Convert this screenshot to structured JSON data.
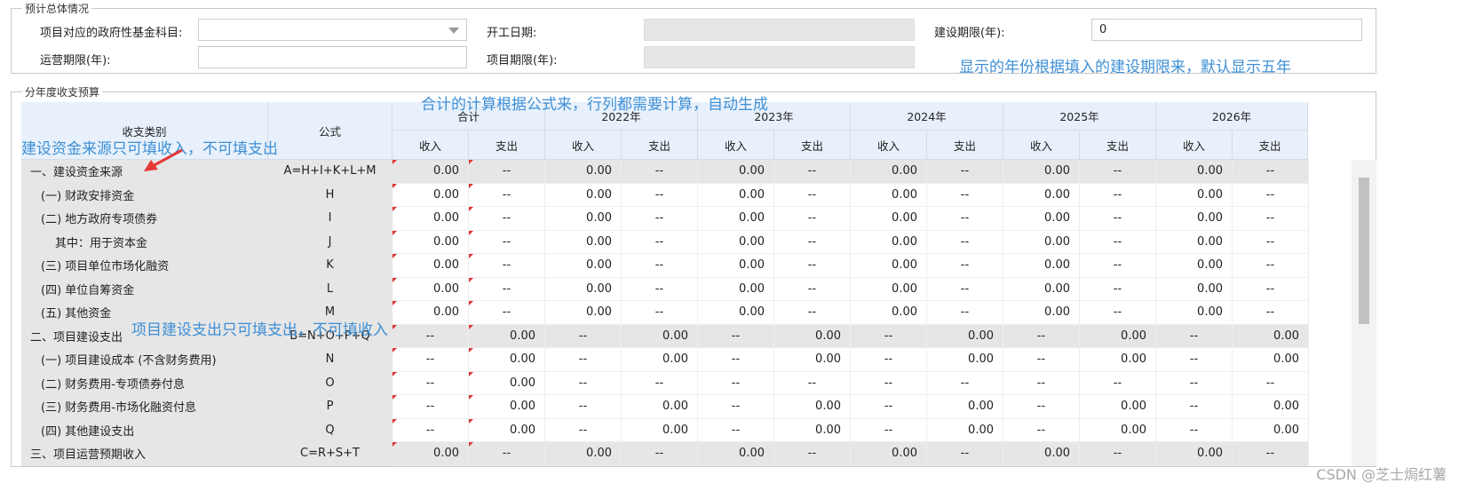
{
  "overview": {
    "legend": "预计总体情况",
    "fund_subject_label": "项目对应的政府性基金科目:",
    "fund_subject_value": "",
    "start_date_label": "开工日期:",
    "build_period_label": "建设期限(年):",
    "build_period_value": "0",
    "operate_period_label": "运营期限(年):",
    "operate_period_value": "",
    "project_period_label": "项目期限(年):"
  },
  "budget": {
    "legend": "分年度收支预算",
    "col_category": "收支类别",
    "col_formula": "公式",
    "groups": [
      "合计",
      "2022年",
      "2023年",
      "2024年",
      "2025年",
      "2026年"
    ],
    "income": "收入",
    "expense": "支出",
    "rows": [
      {
        "label": "一、建设资金来源",
        "formula": "A=H+I+K+L+M",
        "sec": true,
        "values": [
          "0.00",
          "--",
          "0.00",
          "--",
          "0.00",
          "--",
          "0.00",
          "--",
          "0.00",
          "--",
          "0.00",
          "--"
        ]
      },
      {
        "label": "(一) 财政安排资金",
        "formula": "H",
        "values": [
          "0.00",
          "--",
          "0.00",
          "--",
          "0.00",
          "--",
          "0.00",
          "--",
          "0.00",
          "--",
          "0.00",
          "--"
        ]
      },
      {
        "label": "(二) 地方政府专项债券",
        "formula": "I",
        "values": [
          "0.00",
          "--",
          "0.00",
          "--",
          "0.00",
          "--",
          "0.00",
          "--",
          "0.00",
          "--",
          "0.00",
          "--"
        ]
      },
      {
        "label": "其中：用于资本金",
        "formula": "J",
        "indent": true,
        "values": [
          "0.00",
          "--",
          "0.00",
          "--",
          "0.00",
          "--",
          "0.00",
          "--",
          "0.00",
          "--",
          "0.00",
          "--"
        ]
      },
      {
        "label": "(三) 项目单位市场化融资",
        "formula": "K",
        "values": [
          "0.00",
          "--",
          "0.00",
          "--",
          "0.00",
          "--",
          "0.00",
          "--",
          "0.00",
          "--",
          "0.00",
          "--"
        ]
      },
      {
        "label": "(四) 单位自筹资金",
        "formula": "L",
        "values": [
          "0.00",
          "--",
          "0.00",
          "--",
          "0.00",
          "--",
          "0.00",
          "--",
          "0.00",
          "--",
          "0.00",
          "--"
        ]
      },
      {
        "label": "(五) 其他资金",
        "formula": "M",
        "values": [
          "0.00",
          "--",
          "0.00",
          "--",
          "0.00",
          "--",
          "0.00",
          "--",
          "0.00",
          "--",
          "0.00",
          "--"
        ]
      },
      {
        "label": "二、项目建设支出",
        "formula": "B=N+O+P+Q",
        "sec": true,
        "values": [
          "--",
          "0.00",
          "--",
          "0.00",
          "--",
          "0.00",
          "--",
          "0.00",
          "--",
          "0.00",
          "--",
          "0.00"
        ]
      },
      {
        "label": "(一) 项目建设成本 (不含财务费用)",
        "formula": "N",
        "values": [
          "--",
          "0.00",
          "--",
          "0.00",
          "--",
          "0.00",
          "--",
          "0.00",
          "--",
          "0.00",
          "--",
          "0.00"
        ]
      },
      {
        "label": "(二) 财务费用-专项债券付息",
        "formula": "O",
        "values": [
          "--",
          "0.00",
          "--",
          "--",
          "--",
          "--",
          "--",
          "--",
          "--",
          "--",
          "--",
          "--"
        ]
      },
      {
        "label": "(三) 财务费用-市场化融资付息",
        "formula": "P",
        "values": [
          "--",
          "0.00",
          "--",
          "0.00",
          "--",
          "0.00",
          "--",
          "0.00",
          "--",
          "0.00",
          "--",
          "0.00"
        ]
      },
      {
        "label": "(四) 其他建设支出",
        "formula": "Q",
        "values": [
          "--",
          "0.00",
          "--",
          "0.00",
          "--",
          "0.00",
          "--",
          "0.00",
          "--",
          "0.00",
          "--",
          "0.00"
        ]
      },
      {
        "label": "三、项目运营预期收入",
        "formula": "C=R+S+T",
        "sec": true,
        "values": [
          "0.00",
          "--",
          "0.00",
          "--",
          "0.00",
          "--",
          "0.00",
          "--",
          "0.00",
          "--",
          "0.00",
          "--"
        ]
      }
    ]
  },
  "annotations": {
    "years_note": "显示的年份根据填入的建设期限来，默认显示五年",
    "total_note": "合计的计算根据公式来，行列都需要计算，自动生成",
    "source_note": "建设资金来源只可填收入，不可填支出",
    "expense_note": "项目建设支出只可填支出，不可填收入"
  },
  "watermark": "CSDN @芝士焗红薯"
}
